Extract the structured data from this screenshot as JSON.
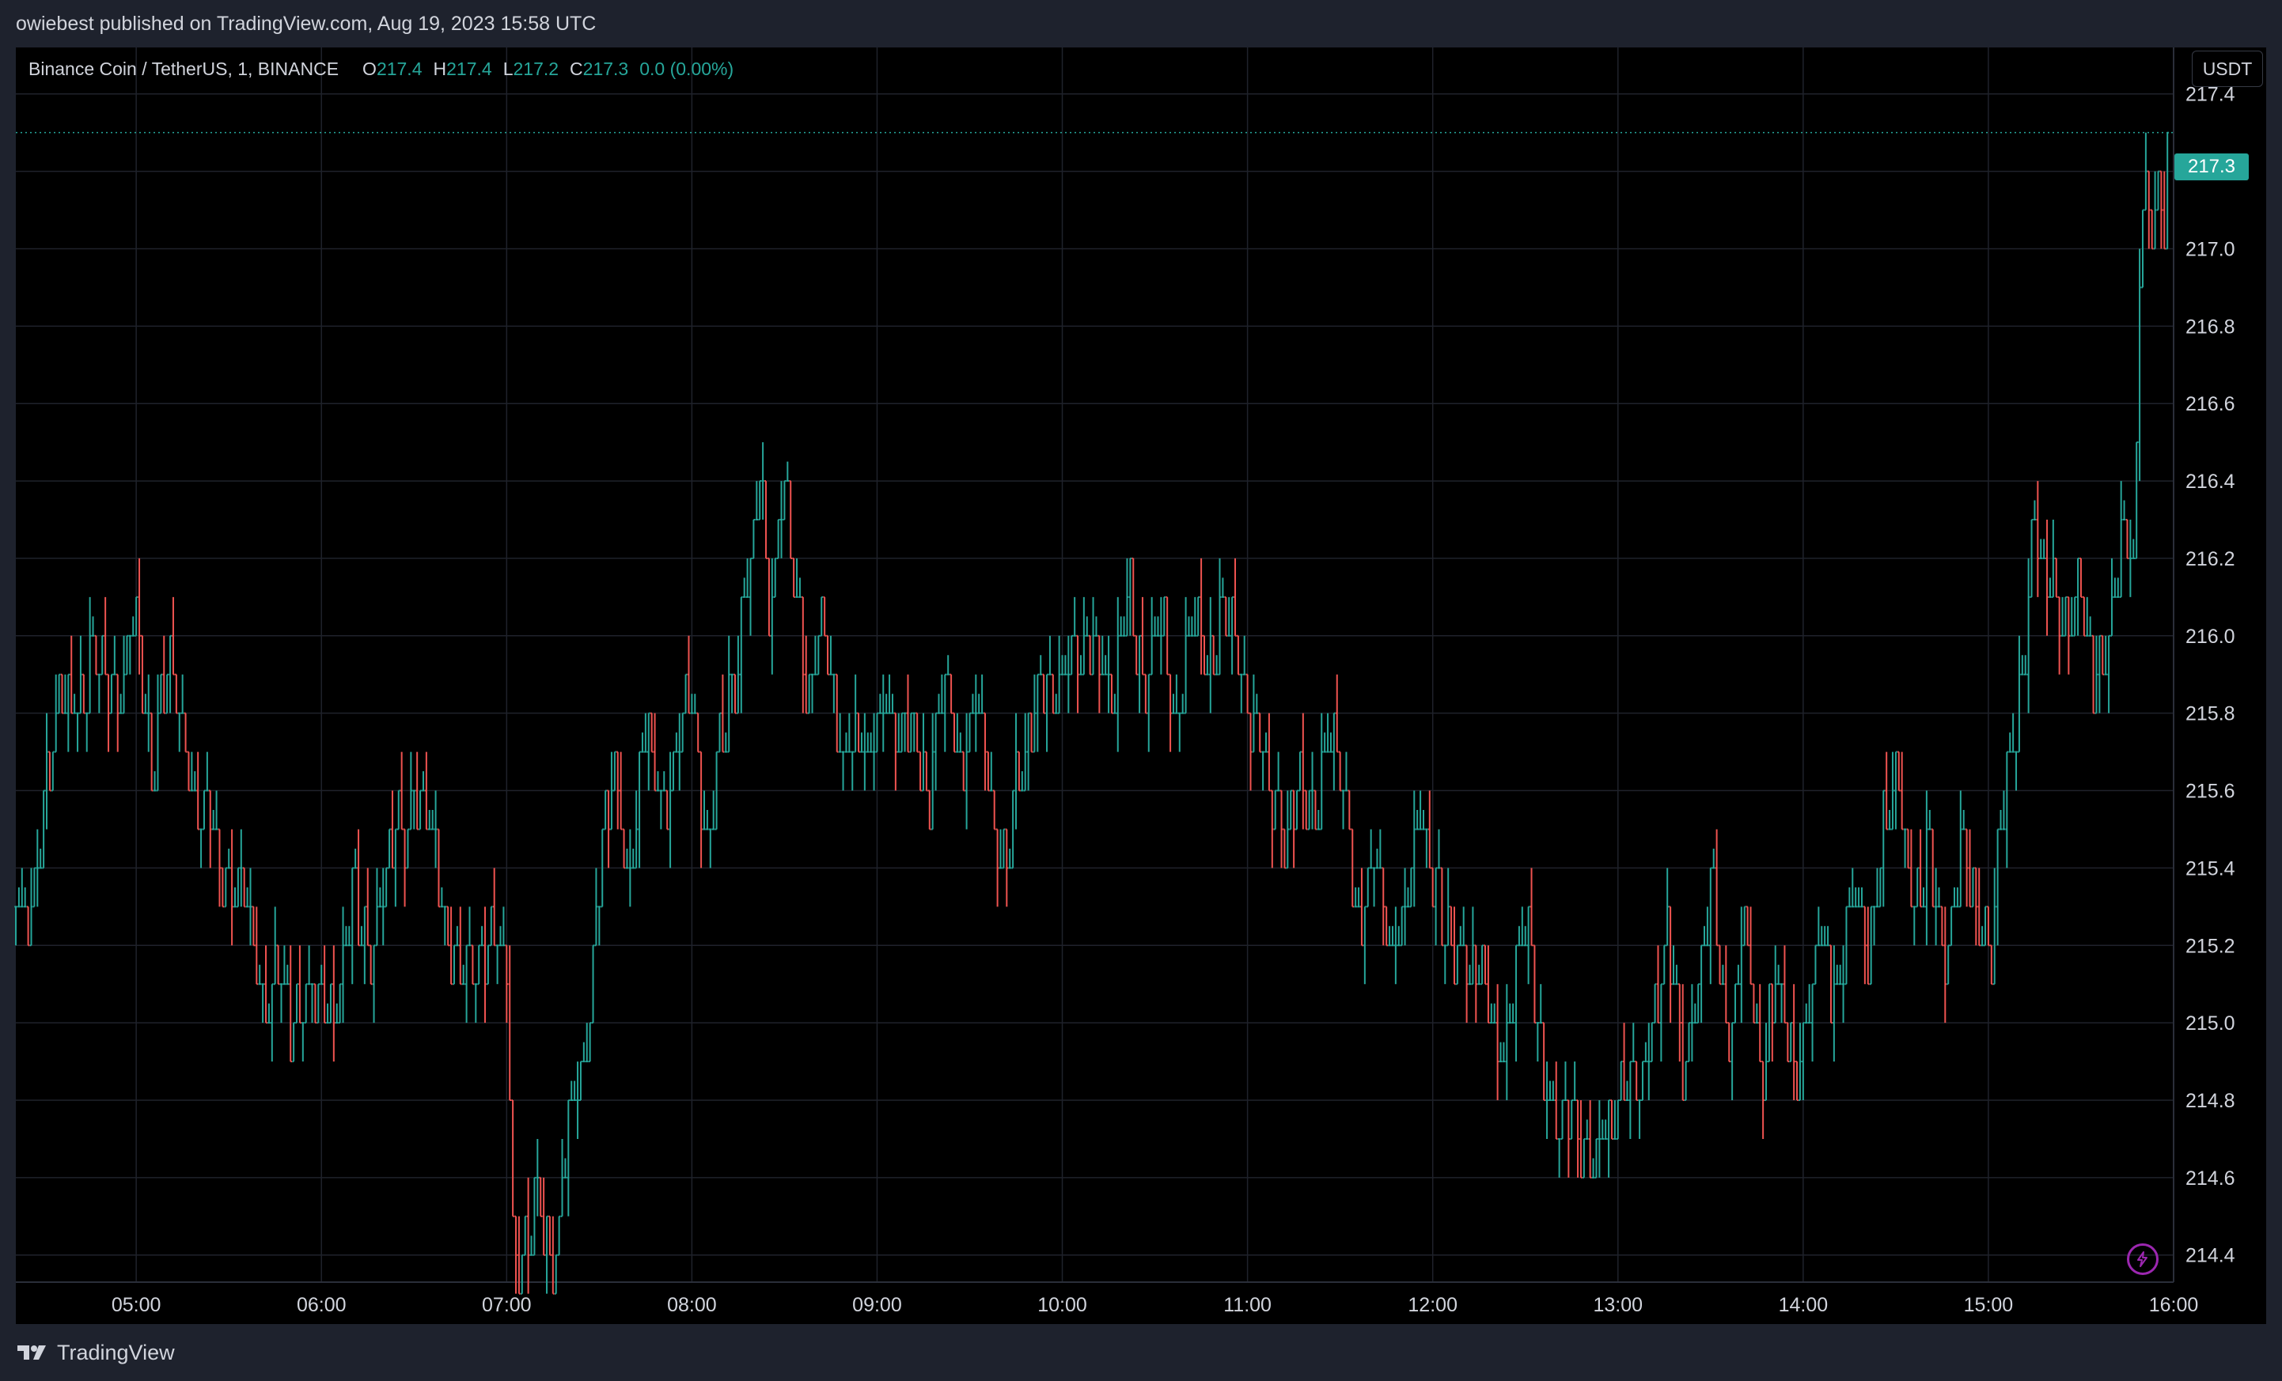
{
  "header": {
    "published_text": "owiebest published on TradingView.com, Aug 19, 2023 15:58 UTC"
  },
  "legend": {
    "symbol": "Binance Coin / TetherUS, 1, BINANCE",
    "o_label": "O",
    "o_value": "217.4",
    "h_label": "H",
    "h_value": "217.4",
    "l_label": "L",
    "l_value": "217.2",
    "c_label": "C",
    "c_value": "217.3",
    "change": "0.0 (0.00%)"
  },
  "currency_button": "USDT",
  "last_price_label": "217.3",
  "footer": {
    "brand": "TradingView"
  },
  "icons": {
    "replay": "lightning-icon",
    "logo": "tradingview-logo-icon"
  },
  "colors": {
    "up": "#26a69a",
    "down": "#ef5350",
    "background": "#000000",
    "grid": "#1f222b",
    "accent": "#9c27b0"
  },
  "chart_data": {
    "type": "ohlc",
    "interval_minutes": 1,
    "x_tick_labels": [
      "05:00",
      "06:00",
      "07:00",
      "08:00",
      "09:00",
      "10:00",
      "11:00",
      "12:00",
      "13:00",
      "14:00",
      "15:00",
      "16:00"
    ],
    "y_tick_labels": [
      "214.4",
      "214.6",
      "214.8",
      "215.0",
      "215.2",
      "215.4",
      "215.6",
      "215.8",
      "216.0",
      "216.2",
      "216.4",
      "216.6",
      "216.8",
      "217.0",
      "217.2",
      "217.4"
    ],
    "ylim": [
      214.33,
      217.52
    ],
    "xlim": [
      "04:21",
      "16:00"
    ],
    "last_price": 217.3,
    "grid": true,
    "close_path": [
      [
        "04:21",
        215.3
      ],
      [
        "04:25",
        215.2
      ],
      [
        "04:30",
        215.6
      ],
      [
        "04:35",
        215.8
      ],
      [
        "04:45",
        215.9
      ],
      [
        "04:55",
        215.9
      ],
      [
        "05:00",
        216.0
      ],
      [
        "05:05",
        215.7
      ],
      [
        "05:10",
        215.9
      ],
      [
        "05:15",
        215.8
      ],
      [
        "05:20",
        215.5
      ],
      [
        "05:25",
        215.5
      ],
      [
        "05:30",
        215.4
      ],
      [
        "05:35",
        215.3
      ],
      [
        "05:40",
        215.1
      ],
      [
        "05:45",
        215.1
      ],
      [
        "05:50",
        215.0
      ],
      [
        "05:55",
        215.1
      ],
      [
        "06:00",
        215.0
      ],
      [
        "06:05",
        215.1
      ],
      [
        "06:10",
        215.3
      ],
      [
        "06:15",
        215.2
      ],
      [
        "06:20",
        215.3
      ],
      [
        "06:25",
        215.5
      ],
      [
        "06:30",
        215.6
      ],
      [
        "06:35",
        215.5
      ],
      [
        "06:40",
        215.3
      ],
      [
        "06:45",
        215.1
      ],
      [
        "06:50",
        215.2
      ],
      [
        "06:55",
        215.2
      ],
      [
        "07:00",
        215.1
      ],
      [
        "07:02",
        214.5
      ],
      [
        "07:05",
        214.4
      ],
      [
        "07:10",
        214.5
      ],
      [
        "07:15",
        214.4
      ],
      [
        "07:20",
        214.7
      ],
      [
        "07:25",
        214.9
      ],
      [
        "07:30",
        215.4
      ],
      [
        "07:35",
        215.6
      ],
      [
        "07:40",
        215.4
      ],
      [
        "07:45",
        215.7
      ],
      [
        "07:50",
        215.6
      ],
      [
        "07:55",
        215.7
      ],
      [
        "08:00",
        215.8
      ],
      [
        "08:05",
        215.5
      ],
      [
        "08:10",
        215.7
      ],
      [
        "08:15",
        216.0
      ],
      [
        "08:20",
        216.2
      ],
      [
        "08:22",
        216.4
      ],
      [
        "08:25",
        216.1
      ],
      [
        "08:30",
        216.4
      ],
      [
        "08:33",
        216.1
      ],
      [
        "08:37",
        215.9
      ],
      [
        "08:42",
        216.0
      ],
      [
        "08:47",
        215.7
      ],
      [
        "08:52",
        215.8
      ],
      [
        "08:57",
        215.6
      ],
      [
        "09:02",
        215.9
      ],
      [
        "09:07",
        215.7
      ],
      [
        "09:12",
        215.8
      ],
      [
        "09:17",
        215.6
      ],
      [
        "09:22",
        215.9
      ],
      [
        "09:27",
        215.7
      ],
      [
        "09:32",
        215.8
      ],
      [
        "09:37",
        215.6
      ],
      [
        "09:42",
        215.4
      ],
      [
        "09:47",
        215.7
      ],
      [
        "09:52",
        215.9
      ],
      [
        "09:57",
        215.8
      ],
      [
        "10:02",
        216.0
      ],
      [
        "10:07",
        215.9
      ],
      [
        "10:12",
        216.0
      ],
      [
        "10:17",
        215.8
      ],
      [
        "10:22",
        216.1
      ],
      [
        "10:27",
        215.9
      ],
      [
        "10:32",
        216.0
      ],
      [
        "10:37",
        215.8
      ],
      [
        "10:42",
        216.0
      ],
      [
        "10:47",
        215.9
      ],
      [
        "10:52",
        216.1
      ],
      [
        "10:57",
        215.9
      ],
      [
        "11:02",
        215.8
      ],
      [
        "11:06",
        215.6
      ],
      [
        "11:11",
        215.5
      ],
      [
        "11:16",
        215.6
      ],
      [
        "11:21",
        215.5
      ],
      [
        "11:26",
        215.8
      ],
      [
        "11:31",
        215.6
      ],
      [
        "11:36",
        215.3
      ],
      [
        "11:41",
        215.4
      ],
      [
        "11:46",
        215.2
      ],
      [
        "11:51",
        215.3
      ],
      [
        "11:56",
        215.5
      ],
      [
        "12:01",
        215.4
      ],
      [
        "12:06",
        215.1
      ],
      [
        "12:11",
        215.2
      ],
      [
        "12:16",
        215.1
      ],
      [
        "12:21",
        214.9
      ],
      [
        "12:26",
        215.1
      ],
      [
        "12:31",
        215.2
      ],
      [
        "12:36",
        214.9
      ],
      [
        "12:41",
        214.7
      ],
      [
        "12:46",
        214.8
      ],
      [
        "12:51",
        214.6
      ],
      [
        "12:56",
        214.7
      ],
      [
        "13:01",
        214.9
      ],
      [
        "13:06",
        214.8
      ],
      [
        "13:11",
        215.0
      ],
      [
        "13:16",
        215.2
      ],
      [
        "13:21",
        214.9
      ],
      [
        "13:26",
        215.1
      ],
      [
        "13:31",
        215.3
      ],
      [
        "13:36",
        215.0
      ],
      [
        "13:41",
        215.2
      ],
      [
        "13:46",
        214.9
      ],
      [
        "13:51",
        215.1
      ],
      [
        "13:56",
        214.9
      ],
      [
        "14:01",
        215.0
      ],
      [
        "14:06",
        215.2
      ],
      [
        "14:11",
        215.1
      ],
      [
        "14:16",
        215.3
      ],
      [
        "14:21",
        215.2
      ],
      [
        "14:26",
        215.5
      ],
      [
        "14:31",
        215.6
      ],
      [
        "14:36",
        215.3
      ],
      [
        "14:41",
        215.4
      ],
      [
        "14:46",
        215.2
      ],
      [
        "14:51",
        215.4
      ],
      [
        "14:56",
        215.3
      ],
      [
        "15:01",
        215.2
      ],
      [
        "15:06",
        215.6
      ],
      [
        "15:09",
        215.8
      ],
      [
        "15:12",
        216.0
      ],
      [
        "15:15",
        216.3
      ],
      [
        "15:18",
        216.1
      ],
      [
        "15:21",
        216.2
      ],
      [
        "15:25",
        216.0
      ],
      [
        "15:30",
        216.1
      ],
      [
        "15:35",
        215.9
      ],
      [
        "15:40",
        216.0
      ],
      [
        "15:44",
        216.3
      ],
      [
        "15:47",
        216.2
      ],
      [
        "15:49",
        216.9
      ],
      [
        "15:51",
        217.1
      ],
      [
        "15:53",
        217.0
      ],
      [
        "15:55",
        217.2
      ],
      [
        "15:57",
        217.1
      ],
      [
        "15:58",
        217.3
      ]
    ]
  }
}
